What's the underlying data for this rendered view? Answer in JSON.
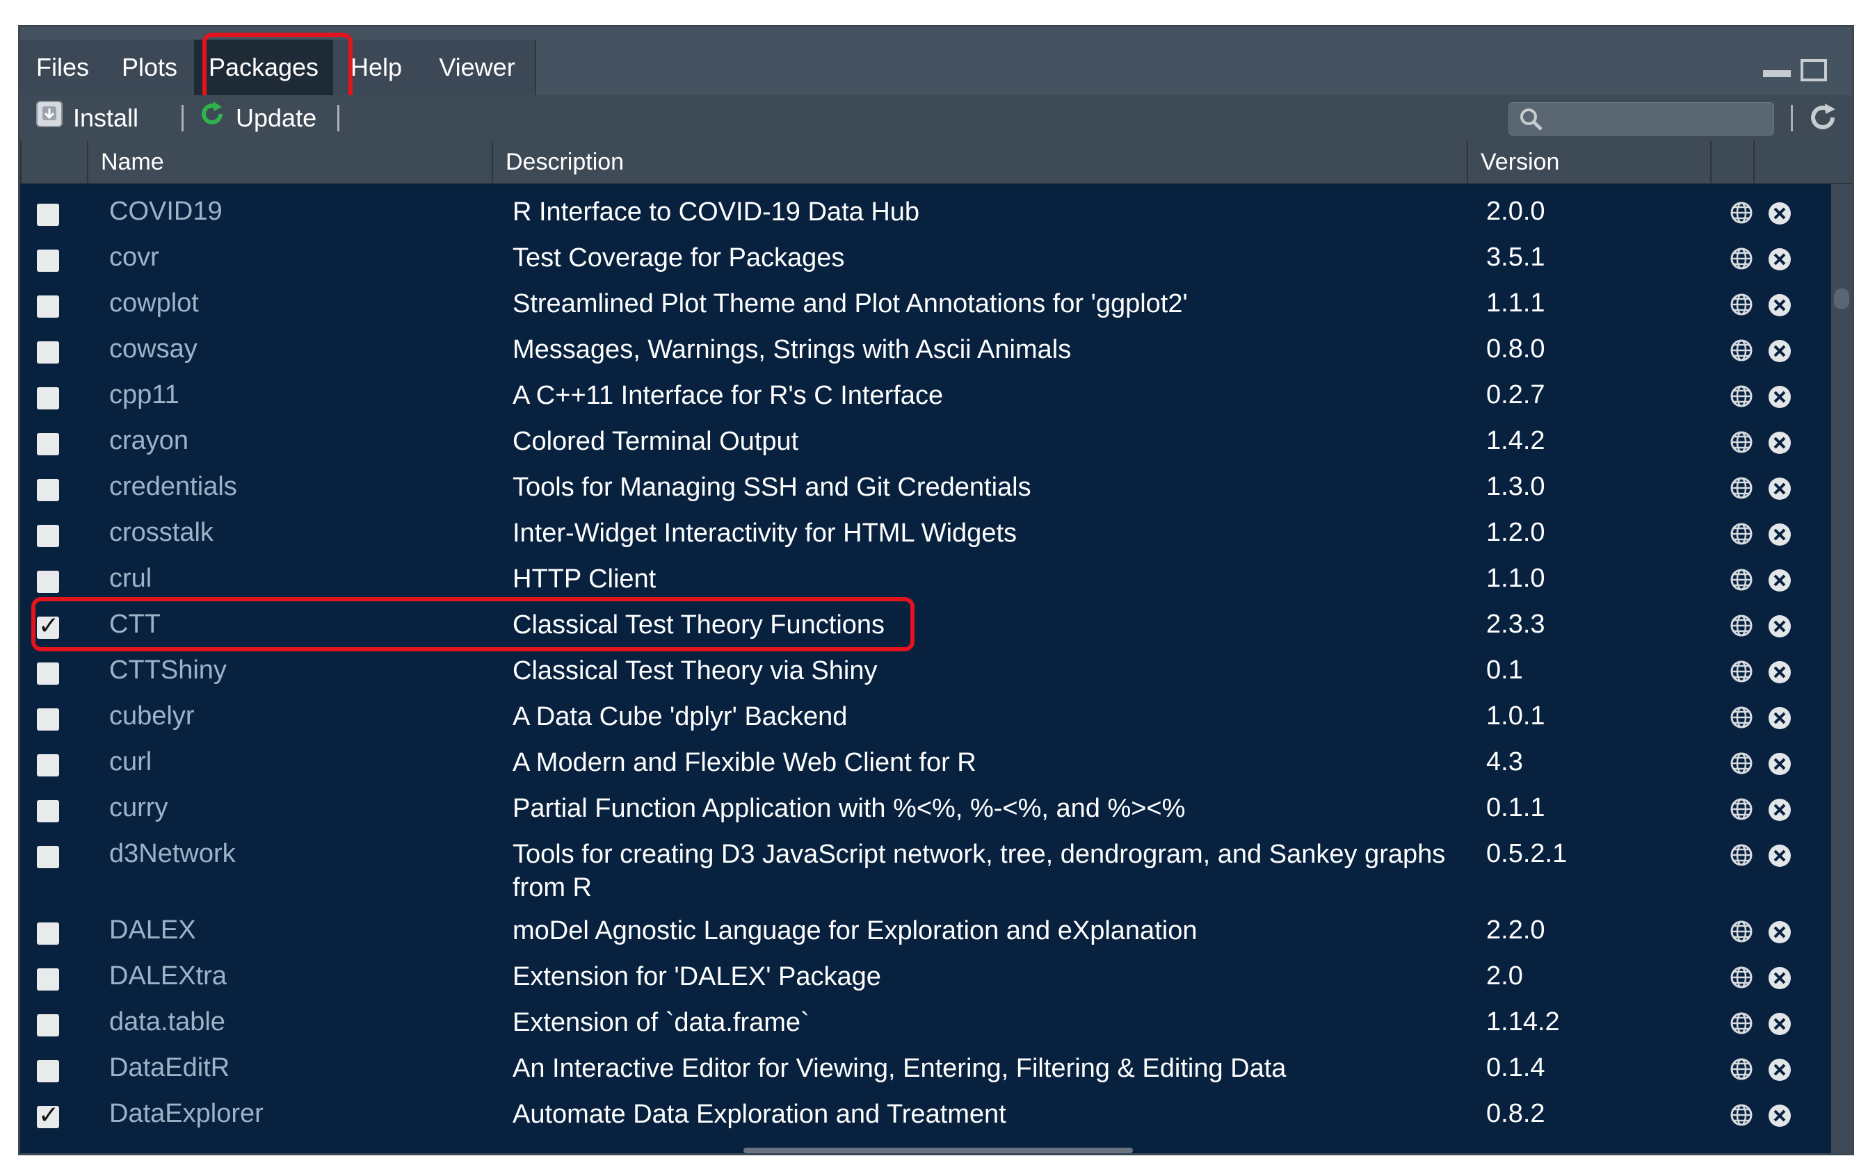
{
  "tabs": [
    {
      "label": "Files",
      "active": false
    },
    {
      "label": "Plots",
      "active": false
    },
    {
      "label": "Packages",
      "active": true
    },
    {
      "label": "Help",
      "active": false
    },
    {
      "label": "Viewer",
      "active": false
    }
  ],
  "toolbar": {
    "install_label": "Install",
    "update_label": "Update",
    "search_placeholder": "",
    "icons": {
      "install": "install-icon",
      "update": "refresh-green-icon",
      "search": "search-icon",
      "refresh": "refresh-icon"
    }
  },
  "columns": {
    "name": "Name",
    "description": "Description",
    "version": "Version"
  },
  "packages": [
    {
      "name": "COVID19",
      "description": "R Interface to COVID-19 Data Hub",
      "version": "2.0.0",
      "checked": false
    },
    {
      "name": "covr",
      "description": "Test Coverage for Packages",
      "version": "3.5.1",
      "checked": false
    },
    {
      "name": "cowplot",
      "description": "Streamlined Plot Theme and Plot Annotations for 'ggplot2'",
      "version": "1.1.1",
      "checked": false
    },
    {
      "name": "cowsay",
      "description": "Messages, Warnings, Strings with Ascii Animals",
      "version": "0.8.0",
      "checked": false
    },
    {
      "name": "cpp11",
      "description": "A C++11 Interface for R's C Interface",
      "version": "0.2.7",
      "checked": false
    },
    {
      "name": "crayon",
      "description": "Colored Terminal Output",
      "version": "1.4.2",
      "checked": false
    },
    {
      "name": "credentials",
      "description": "Tools for Managing SSH and Git Credentials",
      "version": "1.3.0",
      "checked": false
    },
    {
      "name": "crosstalk",
      "description": "Inter-Widget Interactivity for HTML Widgets",
      "version": "1.2.0",
      "checked": false
    },
    {
      "name": "crul",
      "description": "HTTP Client",
      "version": "1.1.0",
      "checked": false
    },
    {
      "name": "CTT",
      "description": "Classical Test Theory Functions",
      "version": "2.3.3",
      "checked": true
    },
    {
      "name": "CTTShiny",
      "description": "Classical Test Theory via Shiny",
      "version": "0.1",
      "checked": false
    },
    {
      "name": "cubelyr",
      "description": "A Data Cube 'dplyr' Backend",
      "version": "1.0.1",
      "checked": false
    },
    {
      "name": "curl",
      "description": "A Modern and Flexible Web Client for R",
      "version": "4.3",
      "checked": false
    },
    {
      "name": "curry",
      "description": "Partial Function Application with %<%, %-<%, and %><%",
      "version": "0.1.1",
      "checked": false
    },
    {
      "name": "d3Network",
      "description": "Tools for creating D3 JavaScript network, tree, dendrogram, and Sankey graphs from R",
      "version": "0.5.2.1",
      "checked": false
    },
    {
      "name": "DALEX",
      "description": "moDel Agnostic Language for Exploration and eXplanation",
      "version": "2.2.0",
      "checked": false
    },
    {
      "name": "DALEXtra",
      "description": "Extension for 'DALEX' Package",
      "version": "2.0",
      "checked": false
    },
    {
      "name": "data.table",
      "description": "Extension of `data.frame`",
      "version": "1.14.2",
      "checked": false
    },
    {
      "name": "DataEditR",
      "description": "An Interactive Editor for Viewing, Entering, Filtering & Editing Data",
      "version": "0.1.4",
      "checked": false
    },
    {
      "name": "DataExplorer",
      "description": "Automate Data Exploration and Treatment",
      "version": "0.8.2",
      "checked": true
    }
  ],
  "colors": {
    "highlight": "#e5131c",
    "rows_bg": "#07213f",
    "pane_bg": "#45525f",
    "name_text": "#9fb3c8"
  },
  "highlights": [
    "tab-packages",
    "package-row-CTT"
  ]
}
